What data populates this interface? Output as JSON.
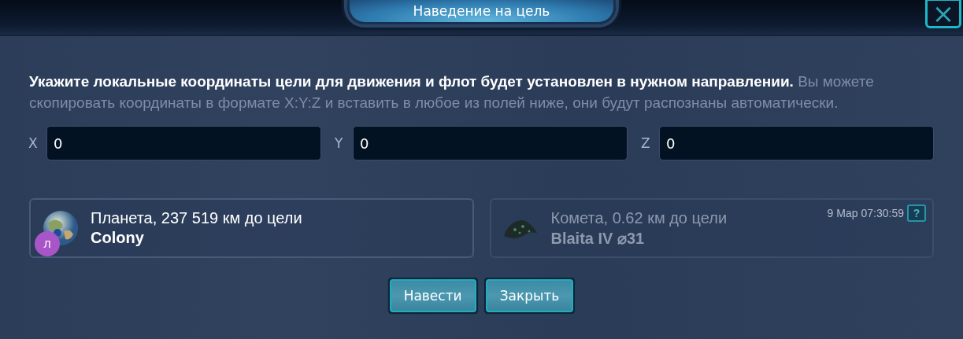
{
  "window": {
    "title": "Наведение на цель",
    "close": "×"
  },
  "instruction": {
    "lead": "Укажите локальные координаты цели для движения и флот будет установлен в нужном направлении.",
    "hint": "Вы можете скопировать координаты в формате X:Y:Z и вставить в любое из полей ниже, они будут распознаны автоматически."
  },
  "fields": [
    {
      "label": "X",
      "value": "0"
    },
    {
      "label": "Y",
      "value": "0"
    },
    {
      "label": "Z",
      "value": "0"
    }
  ],
  "targets": [
    {
      "kind": "planet",
      "dimmed": false,
      "distance": "Планета, 237 519 км до цели",
      "name": "Colony",
      "badge": "Л",
      "color": "#a855c8"
    },
    {
      "kind": "comet",
      "dimmed": true,
      "distance": "Комета, 0.62 км до цели",
      "name": "Blaita IV ⌀31",
      "time": "9 Мар 07:30:59",
      "help": "?"
    }
  ],
  "buttons": [
    {
      "label": "Навести"
    },
    {
      "label": "Закрыть"
    }
  ]
}
